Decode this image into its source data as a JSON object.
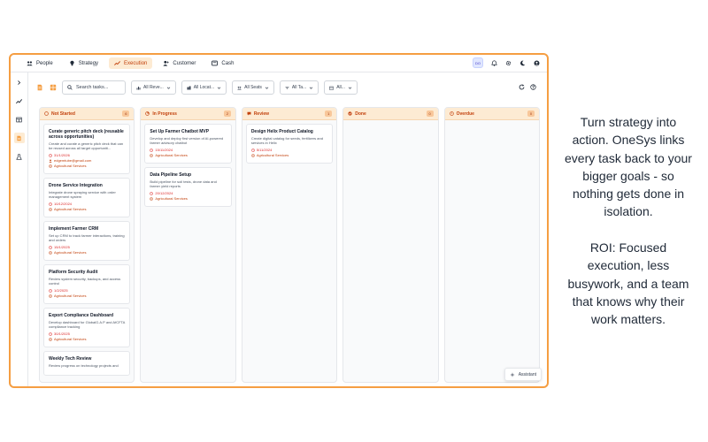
{
  "topnav": {
    "items": [
      {
        "label": "People",
        "icon": "people-icon",
        "active": false
      },
      {
        "label": "Strategy",
        "icon": "lightbulb-icon",
        "active": false
      },
      {
        "label": "Execution",
        "icon": "trend-icon",
        "active": true
      },
      {
        "label": "Customer",
        "icon": "user-plus-icon",
        "active": false
      },
      {
        "label": "Cash",
        "icon": "wallet-icon",
        "active": false
      }
    ],
    "avatar_initials": "DO"
  },
  "toolbar": {
    "search_placeholder": "Search tasks...",
    "filters": [
      "All Reve...",
      "All Locat...",
      "All Seats",
      "All Ta...",
      "All..."
    ]
  },
  "columns": [
    {
      "title": "Not Started",
      "count": "6",
      "cards": [
        {
          "title": "Curate generic pitch deck (reusable across opportunities)",
          "desc": "Create and curate a generic pitch deck that can be reused across all target opportuniti...",
          "date": "31/1/2026",
          "email": "edgemtube@gmail.com",
          "org": "Agricultural Services"
        },
        {
          "title": "Drone Service Integration",
          "desc": "Integrate drone spraying service with order management system",
          "date": "10/12/2024",
          "email": "",
          "org": "Agricultural Services"
        },
        {
          "title": "Implement Farmer CRM",
          "desc": "Set up CRM to track farmer interactions, training and orders",
          "date": "15/1/2025",
          "email": "",
          "org": "Agricultural Services"
        },
        {
          "title": "Platform Security Audit",
          "desc": "Review system security, backups, and access control",
          "date": "1/2/2025",
          "email": "",
          "org": "Agricultural Services"
        },
        {
          "title": "Export Compliance Dashboard",
          "desc": "Develop dashboard for GlobalG.A.P and AfCFTA compliance tracking",
          "date": "30/1/2025",
          "email": "",
          "org": "Agricultural Services"
        },
        {
          "title": "Weekly Tech Review",
          "desc": "Review progress on technology projects and",
          "date": "",
          "email": "",
          "org": ""
        }
      ]
    },
    {
      "title": "In Progress",
      "count": "2",
      "cards": [
        {
          "title": "Set Up Farmer Chatbot MVP",
          "desc": "Develop and deploy first version of AI-powered farmer advisory chatbot",
          "date": "15/11/2024",
          "email": "",
          "org": "Agricultural Services"
        },
        {
          "title": "Data Pipeline Setup",
          "desc": "Build pipeline for soil tests, drone data and farmer yield reports",
          "date": "20/12/2024",
          "email": "",
          "org": "Agricultural Services"
        }
      ]
    },
    {
      "title": "Review",
      "count": "1",
      "cards": [
        {
          "title": "Design Helix Product Catalog",
          "desc": "Create digital catalog for seeds, fertilizers and services in Helix",
          "date": "5/11/2024",
          "email": "",
          "org": "Agricultural Services"
        }
      ]
    },
    {
      "title": "Done",
      "count": "0",
      "cards": []
    },
    {
      "title": "Overdue",
      "count": "0",
      "cards": []
    }
  ],
  "assistant_label": "Assistant",
  "caption": {
    "paragraph1": [
      "Turn strategy into",
      "action. OneSys links",
      "every task back to your",
      "bigger goals - so",
      "nothing gets done in",
      "isolation."
    ],
    "paragraph2": [
      "ROI: Focused",
      "execution, less",
      "busywork, and a team",
      "that knows why their",
      "work matters."
    ]
  },
  "colors": {
    "accent": "#f59e42",
    "accent_text": "#c2410c",
    "header_bg": "#fdebd3",
    "date_red": "#dc2626"
  }
}
